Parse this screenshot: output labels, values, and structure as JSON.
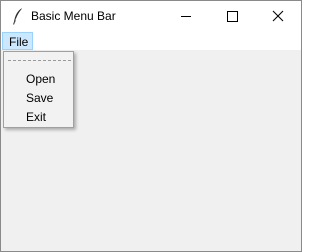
{
  "window": {
    "title": "Basic Menu Bar",
    "icon": "feather-icon"
  },
  "controls": {
    "minimize_icon": "minimize-icon",
    "maximize_icon": "maximize-icon",
    "close_icon": "close-icon"
  },
  "menubar": {
    "file_label": "File"
  },
  "file_menu": {
    "items": [
      {
        "label": "Open"
      },
      {
        "label": "Save"
      },
      {
        "label": "Exit"
      }
    ]
  },
  "colors": {
    "menu_highlight": "#cce8ff",
    "menu_highlight_border": "#99d1ff",
    "client_background": "#f0f0f0"
  }
}
